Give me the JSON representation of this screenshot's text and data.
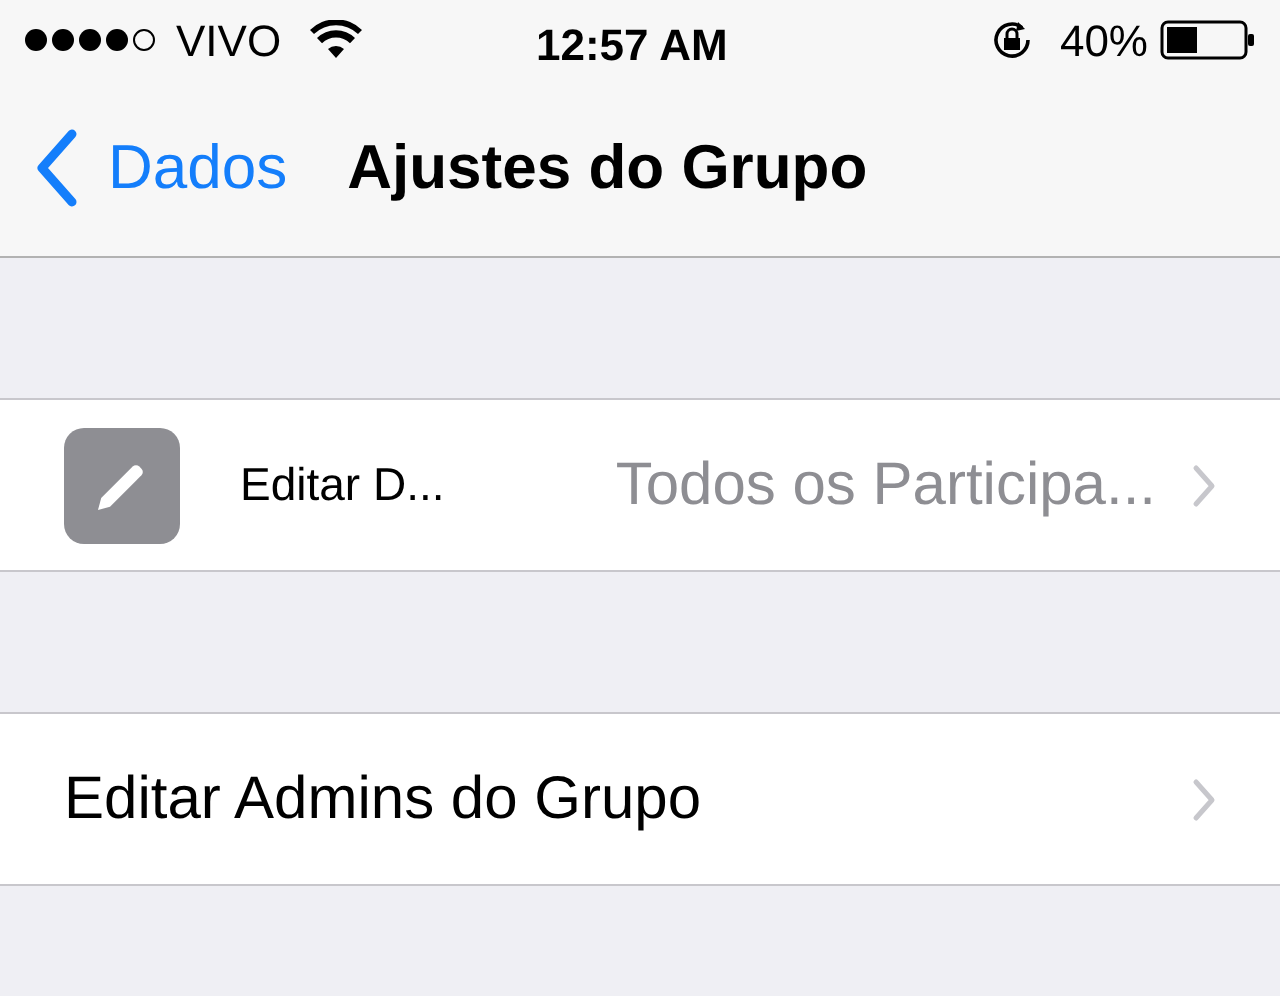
{
  "status_bar": {
    "carrier": "VIVO",
    "time": "12:57 AM",
    "battery": "40%"
  },
  "nav_bar": {
    "back": "Dados",
    "title": "Ajustes do Grupo"
  },
  "sections": [
    {
      "rows": [
        {
          "kind": "icon_value",
          "label": "Editar D...",
          "value": "Todos os Participa..."
        }
      ]
    },
    {
      "rows": [
        {
          "kind": "plain",
          "label": "Editar Admins do Grupo"
        }
      ]
    }
  ]
}
